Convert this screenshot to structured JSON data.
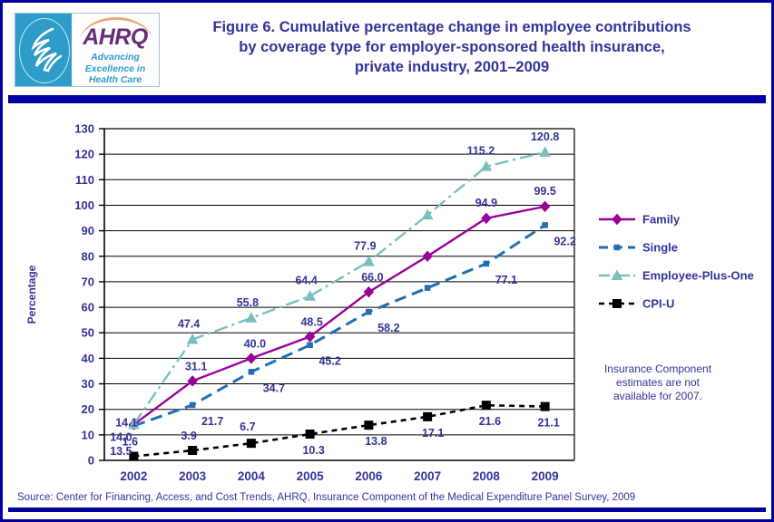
{
  "header": {
    "logo": {
      "agency_abbr": "AHRQ",
      "tagline_line1": "Advancing",
      "tagline_line2": "Excellence in",
      "tagline_line3": "Health Care",
      "seal_name": "hhs-eagle-seal"
    },
    "title_line1": "Figure 6. Cumulative percentage change in employee contributions",
    "title_line2": "by coverage type for employer-sponsored health insurance,",
    "title_line3": "private industry, 2001–2009"
  },
  "footer": {
    "source": "Source: Center for Financing, Access, and Cost Trends, AHRQ, Insurance Component of the Medical Expenditure Panel Survey, 2009"
  },
  "note": {
    "line1": "Insurance Component",
    "line2": "estimates are not",
    "line3": "available for 2007."
  },
  "colors": {
    "family": "#990099",
    "single": "#1F6FB4",
    "employee_plus_one": "#79BFBF",
    "cpiu": "#000000",
    "text": "#333399",
    "border": "#0000A0",
    "rule": "#0000A0"
  },
  "chart_data": {
    "type": "line",
    "title": "Figure 6. Cumulative percentage change in employee contributions by coverage type for employer-sponsored health insurance, private industry, 2001–2009",
    "xlabel": "",
    "ylabel": "Percentage",
    "categories": [
      "2002",
      "2003",
      "2004",
      "2005",
      "2006",
      "2007",
      "2008",
      "2009"
    ],
    "ylim": [
      0,
      130
    ],
    "ytick_step": 10,
    "yticks": [
      "0",
      "10",
      "20",
      "30",
      "40",
      "50",
      "60",
      "70",
      "80",
      "90",
      "100",
      "110",
      "120",
      "130"
    ],
    "grid": "horizontal",
    "legend_position": "right",
    "series": [
      {
        "name": "Family",
        "color": "#990099",
        "marker": "diamond",
        "dash": "solid",
        "values": [
          14.0,
          31.1,
          40.0,
          48.5,
          66.0,
          80.0,
          94.9,
          99.5
        ],
        "labels": [
          "14.0",
          "31.1",
          "40.0",
          "48.5",
          "66.0",
          "",
          "94.9",
          "99.5"
        ]
      },
      {
        "name": "Single",
        "color": "#1F6FB4",
        "marker": "square",
        "dash": "dashed",
        "values": [
          13.5,
          21.7,
          34.7,
          45.2,
          58.2,
          67.6,
          77.1,
          92.2
        ],
        "labels": [
          "13.5",
          "21.7",
          "34.7",
          "45.2",
          "58.2",
          "",
          "77.1",
          "92.2"
        ]
      },
      {
        "name": "Employee-Plus-One",
        "color": "#79BFBF",
        "marker": "triangle",
        "dash": "dashdot",
        "values": [
          14.1,
          47.4,
          55.8,
          64.4,
          77.9,
          96.2,
          115.2,
          120.8
        ],
        "labels": [
          "14.1",
          "47.4",
          "55.8",
          "64.4",
          "77.9",
          "",
          "115.2",
          "120.8"
        ]
      },
      {
        "name": "CPI-U",
        "color": "#000000",
        "marker": "square",
        "dash": "dotted",
        "values": [
          1.6,
          3.9,
          6.7,
          10.3,
          13.8,
          17.1,
          21.6,
          21.1
        ],
        "labels": [
          "1.6",
          "3.9",
          "6.7",
          "10.3",
          "13.8",
          "17.1",
          "21.6",
          "21.1"
        ]
      }
    ]
  }
}
